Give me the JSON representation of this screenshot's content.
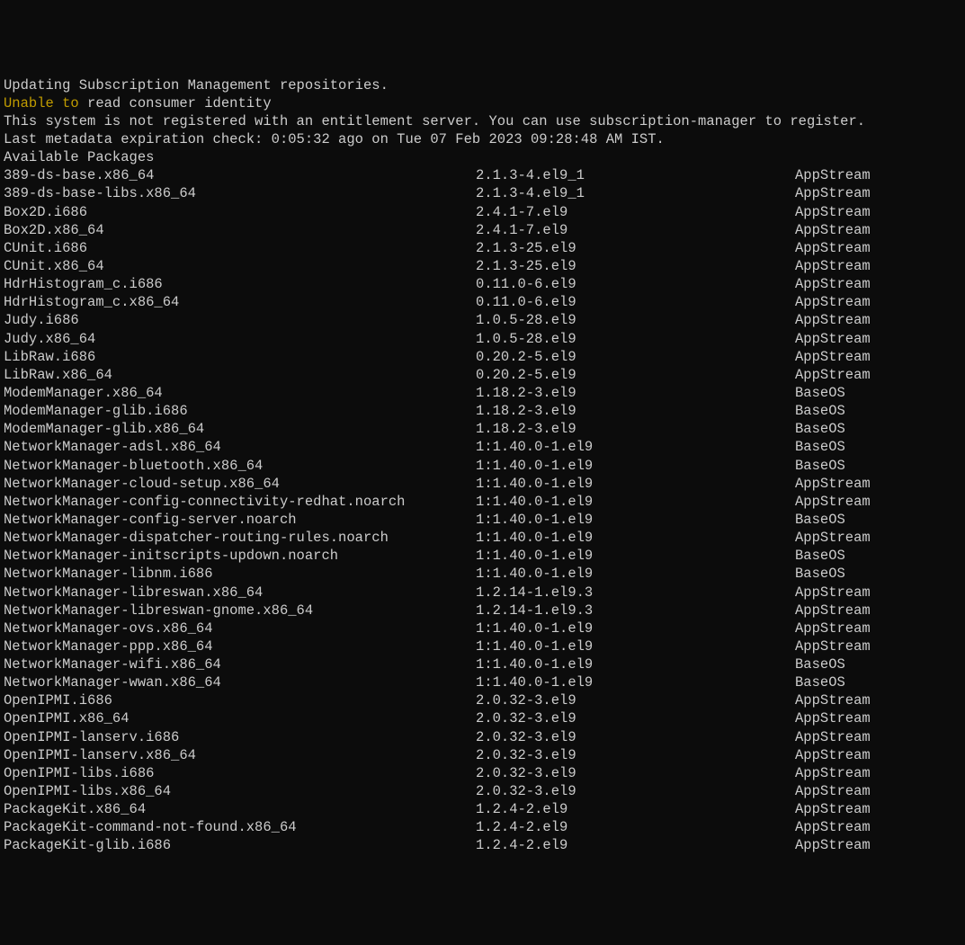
{
  "header": {
    "line1": "Updating Subscription Management repositories.",
    "line2_yellow": "Unable to",
    "line2_rest": " read consumer identity",
    "blank1": "",
    "line3": "This system is not registered with an entitlement server. You can use subscription-manager to register.",
    "blank2": "",
    "line4": "Last metadata expiration check: 0:05:32 ago on Tue 07 Feb 2023 09:28:48 AM IST.",
    "line5": "Available Packages"
  },
  "packages": [
    {
      "name": "389-ds-base.x86_64",
      "version": "2.1.3-4.el9_1",
      "repo": "AppStream"
    },
    {
      "name": "389-ds-base-libs.x86_64",
      "version": "2.1.3-4.el9_1",
      "repo": "AppStream"
    },
    {
      "name": "Box2D.i686",
      "version": "2.4.1-7.el9",
      "repo": "AppStream"
    },
    {
      "name": "Box2D.x86_64",
      "version": "2.4.1-7.el9",
      "repo": "AppStream"
    },
    {
      "name": "CUnit.i686",
      "version": "2.1.3-25.el9",
      "repo": "AppStream"
    },
    {
      "name": "CUnit.x86_64",
      "version": "2.1.3-25.el9",
      "repo": "AppStream"
    },
    {
      "name": "HdrHistogram_c.i686",
      "version": "0.11.0-6.el9",
      "repo": "AppStream"
    },
    {
      "name": "HdrHistogram_c.x86_64",
      "version": "0.11.0-6.el9",
      "repo": "AppStream"
    },
    {
      "name": "Judy.i686",
      "version": "1.0.5-28.el9",
      "repo": "AppStream"
    },
    {
      "name": "Judy.x86_64",
      "version": "1.0.5-28.el9",
      "repo": "AppStream"
    },
    {
      "name": "LibRaw.i686",
      "version": "0.20.2-5.el9",
      "repo": "AppStream"
    },
    {
      "name": "LibRaw.x86_64",
      "version": "0.20.2-5.el9",
      "repo": "AppStream"
    },
    {
      "name": "ModemManager.x86_64",
      "version": "1.18.2-3.el9",
      "repo": "BaseOS"
    },
    {
      "name": "ModemManager-glib.i686",
      "version": "1.18.2-3.el9",
      "repo": "BaseOS"
    },
    {
      "name": "ModemManager-glib.x86_64",
      "version": "1.18.2-3.el9",
      "repo": "BaseOS"
    },
    {
      "name": "NetworkManager-adsl.x86_64",
      "version": "1:1.40.0-1.el9",
      "repo": "BaseOS"
    },
    {
      "name": "NetworkManager-bluetooth.x86_64",
      "version": "1:1.40.0-1.el9",
      "repo": "BaseOS"
    },
    {
      "name": "NetworkManager-cloud-setup.x86_64",
      "version": "1:1.40.0-1.el9",
      "repo": "AppStream"
    },
    {
      "name": "NetworkManager-config-connectivity-redhat.noarch",
      "version": "1:1.40.0-1.el9",
      "repo": "AppStream"
    },
    {
      "name": "NetworkManager-config-server.noarch",
      "version": "1:1.40.0-1.el9",
      "repo": "BaseOS"
    },
    {
      "name": "NetworkManager-dispatcher-routing-rules.noarch",
      "version": "1:1.40.0-1.el9",
      "repo": "AppStream"
    },
    {
      "name": "NetworkManager-initscripts-updown.noarch",
      "version": "1:1.40.0-1.el9",
      "repo": "BaseOS"
    },
    {
      "name": "NetworkManager-libnm.i686",
      "version": "1:1.40.0-1.el9",
      "repo": "BaseOS"
    },
    {
      "name": "NetworkManager-libreswan.x86_64",
      "version": "1.2.14-1.el9.3",
      "repo": "AppStream"
    },
    {
      "name": "NetworkManager-libreswan-gnome.x86_64",
      "version": "1.2.14-1.el9.3",
      "repo": "AppStream"
    },
    {
      "name": "NetworkManager-ovs.x86_64",
      "version": "1:1.40.0-1.el9",
      "repo": "AppStream"
    },
    {
      "name": "NetworkManager-ppp.x86_64",
      "version": "1:1.40.0-1.el9",
      "repo": "AppStream"
    },
    {
      "name": "NetworkManager-wifi.x86_64",
      "version": "1:1.40.0-1.el9",
      "repo": "BaseOS"
    },
    {
      "name": "NetworkManager-wwan.x86_64",
      "version": "1:1.40.0-1.el9",
      "repo": "BaseOS"
    },
    {
      "name": "OpenIPMI.i686",
      "version": "2.0.32-3.el9",
      "repo": "AppStream"
    },
    {
      "name": "OpenIPMI.x86_64",
      "version": "2.0.32-3.el9",
      "repo": "AppStream"
    },
    {
      "name": "OpenIPMI-lanserv.i686",
      "version": "2.0.32-3.el9",
      "repo": "AppStream"
    },
    {
      "name": "OpenIPMI-lanserv.x86_64",
      "version": "2.0.32-3.el9",
      "repo": "AppStream"
    },
    {
      "name": "OpenIPMI-libs.i686",
      "version": "2.0.32-3.el9",
      "repo": "AppStream"
    },
    {
      "name": "OpenIPMI-libs.x86_64",
      "version": "2.0.32-3.el9",
      "repo": "AppStream"
    },
    {
      "name": "PackageKit.x86_64",
      "version": "1.2.4-2.el9",
      "repo": "AppStream"
    },
    {
      "name": "PackageKit-command-not-found.x86_64",
      "version": "1.2.4-2.el9",
      "repo": "AppStream"
    },
    {
      "name": "PackageKit-glib.i686",
      "version": "1.2.4-2.el9",
      "repo": "AppStream"
    }
  ]
}
